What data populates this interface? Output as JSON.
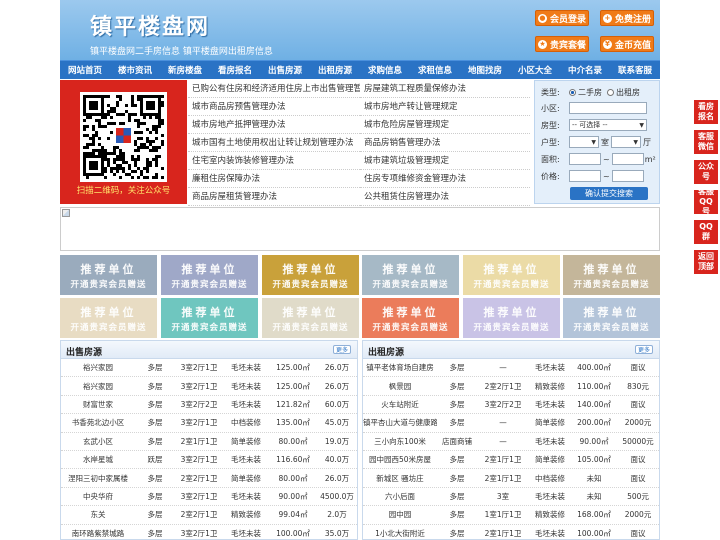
{
  "header": {
    "title": "镇平楼盘网",
    "subtitle": "镇平楼盘网二手房信息    镇平楼盘网出租房信息",
    "buttons": {
      "login": "会员登录",
      "register": "免费注册",
      "vip": "贵宾套餐",
      "gold": "金币充值"
    },
    "accent_color": "#f07b18"
  },
  "nav": {
    "items": [
      "网站首页",
      "楼市资讯",
      "新房楼盘",
      "看房报名",
      "出售房源",
      "出租房源",
      "求购信息",
      "求租信息",
      "地图找房",
      "小区大全",
      "中介名录",
      "联系客服"
    ]
  },
  "qr": {
    "caption": "扫描二维码，关注公众号"
  },
  "policy": {
    "left": [
      "已购公有住房和经济适用住房上市出售管理暂",
      "城市商品房预售管理办法",
      "城市房地产抵押管理办法",
      "城市国有土地使用权出让转让规划管理办法",
      "住宅室内装饰装修管理办法",
      "廉租住房保障办法",
      "商品房屋租赁管理办法"
    ],
    "right": [
      "房屋建筑工程质量保修办法",
      "城市房地产转让管理规定",
      "城市危险房屋管理规定",
      "商品房销售管理办法",
      "城市建筑垃圾管理规定",
      "住房专项维修资金管理办法",
      "公共租赁住房管理办法"
    ]
  },
  "search": {
    "type_label": "类型:",
    "type_options": [
      "二手房",
      "出租房"
    ],
    "community_label": "小区:",
    "room_label": "房型:",
    "room_select": "-- 可选择 --",
    "layout_label": "户型:",
    "shi": "室",
    "ting": "厅",
    "area_label": "面积:",
    "price_label": "价格:",
    "tilde": "~",
    "sqm": "m²",
    "submit": "确认提交搜索"
  },
  "ads": {
    "line1": "推荐单位",
    "line2": "开通贵宾会员赠送",
    "colors": [
      "#9aabbd",
      "#9fa8c8",
      "#c9a13a",
      "#a6b9c6",
      "#ebdba6",
      "#c4b69a",
      "#e8dcc3",
      "#6fc6bf",
      "#e0dbc9",
      "#eb7c5b",
      "#c9c3e6",
      "#b3c4d9"
    ]
  },
  "sale": {
    "title": "出售房源",
    "more": "更多",
    "rows": [
      [
        "裕兴家园",
        "多层",
        "3室2厅1卫",
        "毛坯未装",
        "125.00㎡",
        "26.0万"
      ],
      [
        "裕兴家园",
        "多层",
        "3室2厅1卫",
        "毛坯未装",
        "125.00㎡",
        "26.0万"
      ],
      [
        "财富世家",
        "多层",
        "3室2厅2卫",
        "毛坯未装",
        "121.82㎡",
        "60.0万"
      ],
      [
        "书香苑北边小区",
        "多层",
        "3室2厅1卫",
        "中档装修",
        "135.00㎡",
        "45.0万"
      ],
      [
        "玄武小区",
        "多层",
        "2室1厅1卫",
        "简单装修",
        "80.00㎡",
        "19.0万"
      ],
      [
        "水岸星城",
        "跃层",
        "3室2厅1卫",
        "毛坯未装",
        "116.60㎡",
        "40.0万"
      ],
      [
        "涅阳三初中家属楼",
        "多层",
        "2室2厅1卫",
        "简单装修",
        "80.00㎡",
        "26.0万"
      ],
      [
        "中央华府",
        "多层",
        "3室2厅1卫",
        "毛坯未装",
        "90.00㎡",
        "4500.0万"
      ],
      [
        "东关",
        "多层",
        "2室2厅1卫",
        "精致装修",
        "99.04㎡",
        "2.0万"
      ],
      [
        "南环路紫禁城路",
        "多层",
        "3室2厅1卫",
        "毛坯未装",
        "100.00㎡",
        "35.0万"
      ]
    ]
  },
  "rent": {
    "title": "出租房源",
    "more": "更多",
    "rows": [
      [
        "镇平老体育场自建房",
        "多层",
        "—",
        "毛坯未装",
        "400.00㎡",
        "面议"
      ],
      [
        "枫景园",
        "多层",
        "2室2厅1卫",
        "精致装修",
        "110.00㎡",
        "830元"
      ],
      [
        "火车站附近",
        "多层",
        "3室2厅2卫",
        "毛坯未装",
        "140.00㎡",
        "面议"
      ],
      [
        "镇平杏山大道与健康路",
        "多层",
        "—",
        "简单装修",
        "200.00㎡",
        "2000元"
      ],
      [
        "三小向东100米",
        "店面商铺",
        "—",
        "毛坯未装",
        "90.00㎡",
        "50000元"
      ],
      [
        "园中园西50米房屋",
        "多层",
        "2室1厅1卫",
        "简单装修",
        "105.00㎡",
        "面议"
      ],
      [
        "新城区 骚坊庄",
        "多层",
        "2室1厅1卫",
        "中档装修",
        "未知",
        "面议"
      ],
      [
        "六小后面",
        "多层",
        "3室",
        "毛坯未装",
        "未知",
        "500元"
      ],
      [
        "园中园",
        "多层",
        "1室1厅1卫",
        "精致装修",
        "168.00㎡",
        "2000元"
      ],
      [
        "1小北大街附近",
        "多层",
        "2室1厅1卫",
        "毛坯未装",
        "100.00㎡",
        "面议"
      ]
    ]
  },
  "side": {
    "items": [
      "看房报名",
      "客服微信",
      "公众号",
      "客服QQ号",
      "QQ群",
      "返回顶部"
    ]
  }
}
